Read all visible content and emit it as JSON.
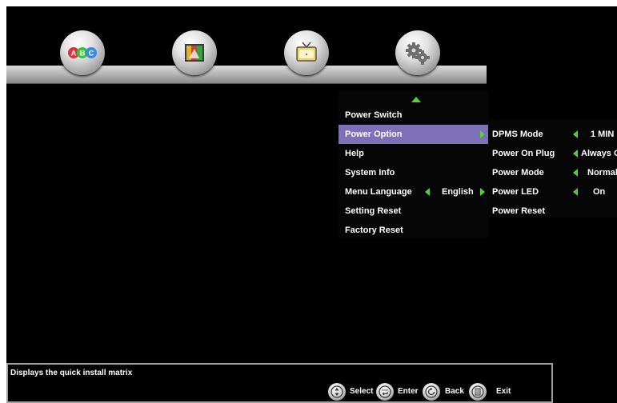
{
  "categories": [
    {
      "name": "abc-icon",
      "letters": [
        "A",
        "B",
        "C"
      ]
    },
    {
      "name": "picture-icon"
    },
    {
      "name": "tv-icon"
    },
    {
      "name": "gear-icon"
    }
  ],
  "main_menu": {
    "items": [
      {
        "label": "Power Switch"
      },
      {
        "label": "Power Option",
        "selected": true
      },
      {
        "label": "Help"
      },
      {
        "label": "System Info"
      },
      {
        "label": "Menu Language",
        "value": "English"
      },
      {
        "label": "Setting Reset"
      },
      {
        "label": "Factory Reset"
      }
    ]
  },
  "sub_menu": {
    "items": [
      {
        "label": "DPMS Mode",
        "value": "1 MIN"
      },
      {
        "label": "Power On Plug",
        "value": "Always Off"
      },
      {
        "label": "Power Mode",
        "value": "Normal"
      },
      {
        "label": "Power LED",
        "value": "On"
      },
      {
        "label": "Power Reset"
      }
    ]
  },
  "help": {
    "text": "Displays the quick install matrix",
    "hints": {
      "select": "Select",
      "enter": "Enter",
      "enter_icon_text": "Enter",
      "back": "Back",
      "exit": "Exit"
    }
  },
  "colors": {
    "selection": "#7e6fb9",
    "arrow": "#54d13a",
    "background": "#000000",
    "abc_red": "#e0323c",
    "abc_green": "#3cc43c",
    "abc_blue": "#3a8ae0"
  }
}
